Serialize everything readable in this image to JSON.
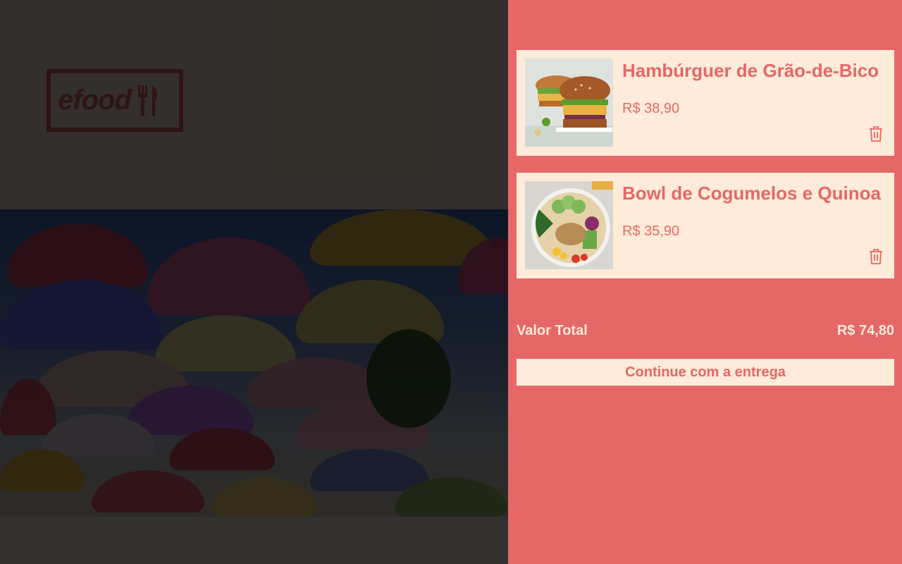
{
  "site": {
    "logo_text": "efood"
  },
  "cart": {
    "items": [
      {
        "name": "Hambúrguer de Grão-de-Bico",
        "price": "R$ 38,90"
      },
      {
        "name": "Bowl de Cogumelos e Quinoa",
        "price": "R$ 35,90"
      }
    ],
    "total_label": "Valor Total",
    "total_value": "R$ 74,80",
    "continue_label": "Continue com a entrega"
  },
  "colors": {
    "accent": "#E66767",
    "cream": "#FFEBD9",
    "overlay": "rgba(0,0,0,0.8)"
  }
}
